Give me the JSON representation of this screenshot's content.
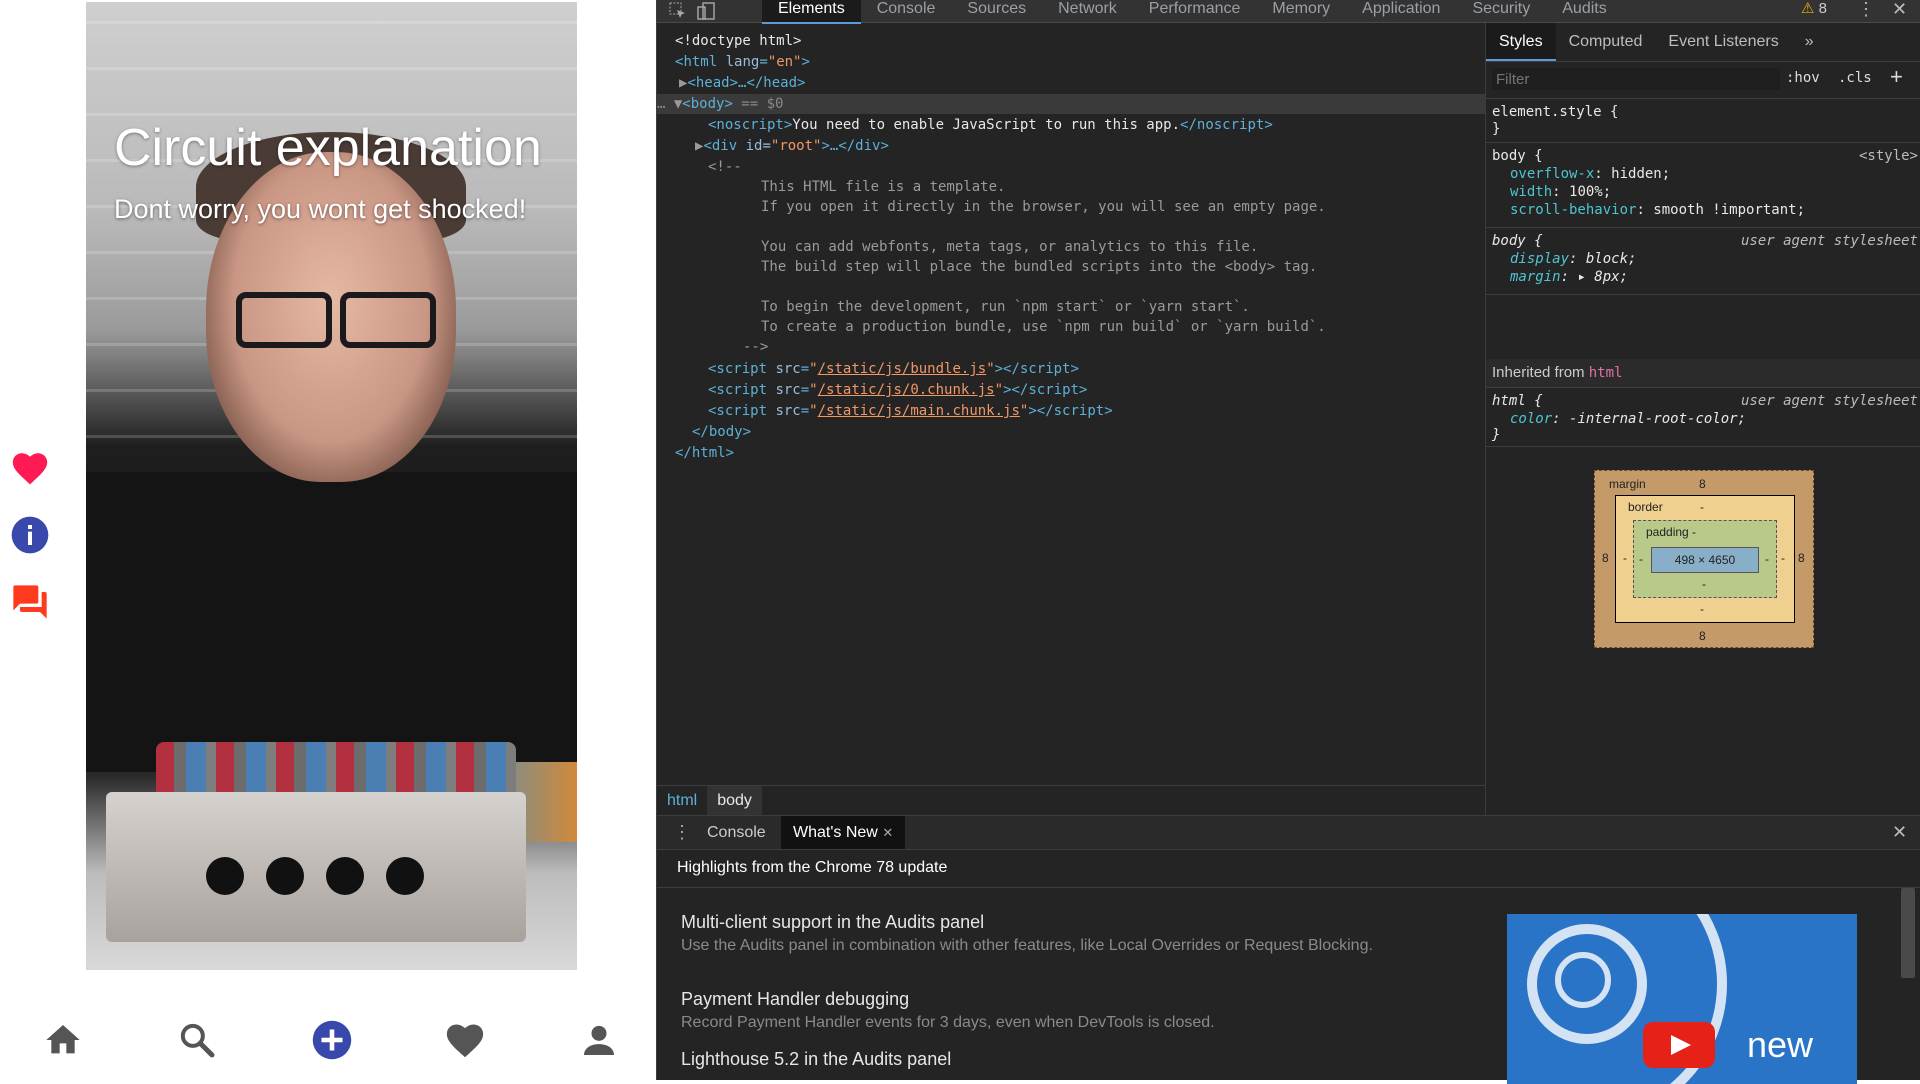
{
  "app": {
    "video_title": "Circuit explanation",
    "video_subtitle": "Dont worry, you wont get shocked!",
    "side_icons": [
      "heart-icon",
      "info-icon",
      "comments-icon"
    ],
    "nav_icons": [
      "home-icon",
      "search-icon",
      "add-icon",
      "heart-icon",
      "profile-icon"
    ],
    "colors": {
      "heart": "#ff1a55",
      "info": "#3949ab",
      "comments": "#ff3b1f",
      "add": "#3949ab",
      "nav": "#555555"
    }
  },
  "devtools": {
    "tabs": [
      "Elements",
      "Console",
      "Sources",
      "Network",
      "Performance",
      "Memory",
      "Application",
      "Security",
      "Audits"
    ],
    "active_tab": "Elements",
    "warning_count": "8",
    "dom": {
      "doctype": "<!doctype html>",
      "html_open_tag": "html",
      "html_lang_attr": "lang",
      "html_lang_val": "en",
      "head_text": "<head>…</head>",
      "body_text": "<body>",
      "body_ref": " == $0",
      "noscript_open": "<noscript>",
      "noscript_text": "You need to enable JavaScript to run this app.",
      "noscript_close": "</noscript>",
      "div_tag": "<div ",
      "div_attr": "id=",
      "div_val": "\"root\"",
      "div_rest": ">…</div>",
      "comment_open": "<!--",
      "comment_lines": [
        "This HTML file is a template.",
        "If you open it directly in the browser, you will see an empty page.",
        "",
        "You can add webfonts, meta tags, or analytics to this file.",
        "The build step will place the bundled scripts into the <body> tag.",
        "",
        "To begin the development, run `npm start` or `yarn start`.",
        "To create a production bundle, use `npm run build` or `yarn build`."
      ],
      "comment_close": "-->",
      "scripts": [
        "/static/js/bundle.js",
        "/static/js/0.chunk.js",
        "/static/js/main.chunk.js"
      ],
      "body_close": "</body>",
      "html_close": "</html>"
    },
    "breadcrumbs": [
      "html",
      "body"
    ],
    "styles": {
      "subtabs": [
        "Styles",
        "Computed",
        "Event Listeners"
      ],
      "more": "»",
      "filter_placeholder": "Filter",
      "hov": ":hov",
      "cls": ".cls",
      "plus": "+",
      "element_style": "element.style {",
      "close_brace": "}",
      "rule1": {
        "selector": "body {",
        "source": "<style>",
        "props": [
          {
            "name": "overflow-x",
            "value": "hidden;"
          },
          {
            "name": "width",
            "value": "100%;"
          },
          {
            "name": "scroll-behavior",
            "value": "smooth !important;"
          }
        ]
      },
      "rule2": {
        "selector": "body {",
        "source": "user agent stylesheet",
        "props": [
          {
            "name": "display",
            "value": "block;"
          },
          {
            "name": "margin",
            "value": "▸ 8px;"
          }
        ]
      },
      "inherited_label": "Inherited from",
      "inherited_from": "html",
      "rule3": {
        "selector": "html {",
        "source": "user agent stylesheet",
        "props": [
          {
            "name": "color",
            "value": "-internal-root-color;"
          }
        ]
      },
      "box_model": {
        "margin_label": "margin",
        "margin_top": "8",
        "margin_bottom": "8",
        "margin_left": "8",
        "margin_right": "8",
        "border_label": "border",
        "border_value": "-",
        "padding_label": "padding -",
        "padding_side": "-",
        "content": "498 × 4650"
      }
    },
    "drawer": {
      "tabs": [
        "Console",
        "What's New"
      ],
      "active_tab": "What's New",
      "heading": "Highlights from the Chrome 78 update",
      "items": [
        {
          "title": "Multi-client support in the Audits panel",
          "desc": "Use the Audits panel in combination with other features, like Local Overrides or Request Blocking."
        },
        {
          "title": "Payment Handler debugging",
          "desc": "Record Payment Handler events for 3 days, even when DevTools is closed."
        },
        {
          "title": "Lighthouse 5.2 in the Audits panel",
          "desc": ""
        }
      ],
      "promo_text": "new"
    }
  }
}
